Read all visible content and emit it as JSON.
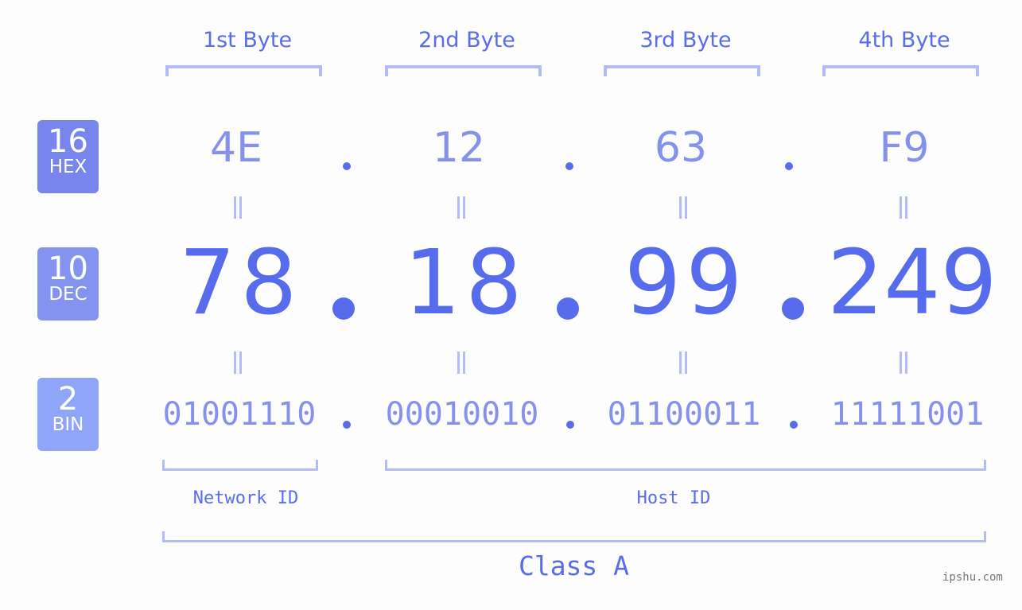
{
  "bytes": [
    {
      "title": "1st Byte",
      "hex": "4E",
      "dec": "78",
      "bin": "01001110"
    },
    {
      "title": "2nd Byte",
      "hex": "12",
      "dec": "18",
      "bin": "00010010"
    },
    {
      "title": "3rd Byte",
      "hex": "63",
      "dec": "99",
      "bin": "01100011"
    },
    {
      "title": "4th Byte",
      "hex": "F9",
      "dec": "249",
      "bin": "11111001"
    }
  ],
  "badges": {
    "hex": {
      "number": "16",
      "label": "HEX",
      "color": "#7885ec"
    },
    "dec": {
      "number": "10",
      "label": "DEC",
      "color": "#8593f0"
    },
    "bin": {
      "number": "2",
      "label": "BIN",
      "color": "#8fa6f8"
    }
  },
  "separator": ".",
  "equals_symbol": "=",
  "segments": {
    "network_id": "Network ID",
    "host_id": "Host ID"
  },
  "ip_class": "Class A",
  "watermark": "ipshu.com",
  "colors": {
    "accent": "#566ced",
    "light_value": "#8591ea",
    "bracket": "#b3bcf6"
  }
}
